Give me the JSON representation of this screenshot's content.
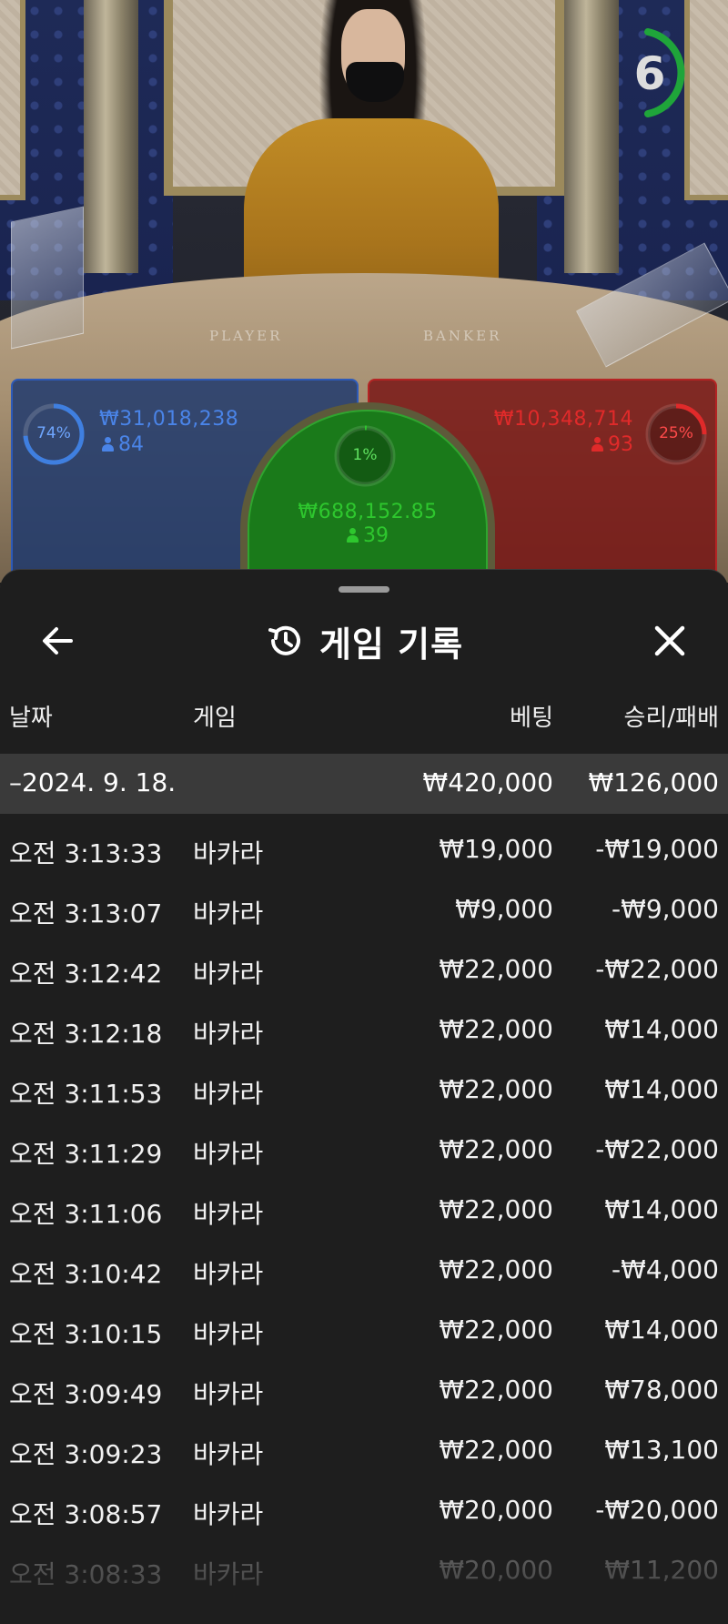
{
  "video": {
    "table_player_text": "PLAYER",
    "table_banker_text": "BANKER",
    "timer": "6"
  },
  "bets": {
    "player": {
      "percent": "74%",
      "amount": "₩31,018,238",
      "players": "84",
      "color": "#3f7fe0",
      "percent_value": 74
    },
    "tie": {
      "percent": "1%",
      "amount": "₩688,152.85",
      "players": "39",
      "color": "#2ec72e",
      "percent_value": 1
    },
    "banker": {
      "percent": "25%",
      "amount": "₩10,348,714",
      "players": "93",
      "color": "#e02a2a",
      "percent_value": 25
    }
  },
  "sheet": {
    "title": "게임 기록",
    "columns": {
      "date": "날짜",
      "game": "게임",
      "bet": "베팅",
      "winloss": "승리/패배"
    },
    "group": {
      "date": "–2024. 9. 18.",
      "bet": "₩420,000",
      "winloss": "₩126,000"
    },
    "rows": [
      {
        "time": "오전 3:13:33",
        "game": "바카라",
        "bet": "₩19,000",
        "winloss": "-₩19,000"
      },
      {
        "time": "오전 3:13:07",
        "game": "바카라",
        "bet": "₩9,000",
        "winloss": "-₩9,000"
      },
      {
        "time": "오전 3:12:42",
        "game": "바카라",
        "bet": "₩22,000",
        "winloss": "-₩22,000"
      },
      {
        "time": "오전 3:12:18",
        "game": "바카라",
        "bet": "₩22,000",
        "winloss": "₩14,000"
      },
      {
        "time": "오전 3:11:53",
        "game": "바카라",
        "bet": "₩22,000",
        "winloss": "₩14,000"
      },
      {
        "time": "오전 3:11:29",
        "game": "바카라",
        "bet": "₩22,000",
        "winloss": "-₩22,000"
      },
      {
        "time": "오전 3:11:06",
        "game": "바카라",
        "bet": "₩22,000",
        "winloss": "₩14,000"
      },
      {
        "time": "오전 3:10:42",
        "game": "바카라",
        "bet": "₩22,000",
        "winloss": "-₩4,000"
      },
      {
        "time": "오전 3:10:15",
        "game": "바카라",
        "bet": "₩22,000",
        "winloss": "₩14,000"
      },
      {
        "time": "오전 3:09:49",
        "game": "바카라",
        "bet": "₩22,000",
        "winloss": "₩78,000"
      },
      {
        "time": "오전 3:09:23",
        "game": "바카라",
        "bet": "₩22,000",
        "winloss": "₩13,100"
      },
      {
        "time": "오전 3:08:57",
        "game": "바카라",
        "bet": "₩20,000",
        "winloss": "-₩20,000"
      },
      {
        "time": "오전 3:08:33",
        "game": "바카라",
        "bet": "₩20,000",
        "winloss": "₩11,200"
      }
    ]
  }
}
